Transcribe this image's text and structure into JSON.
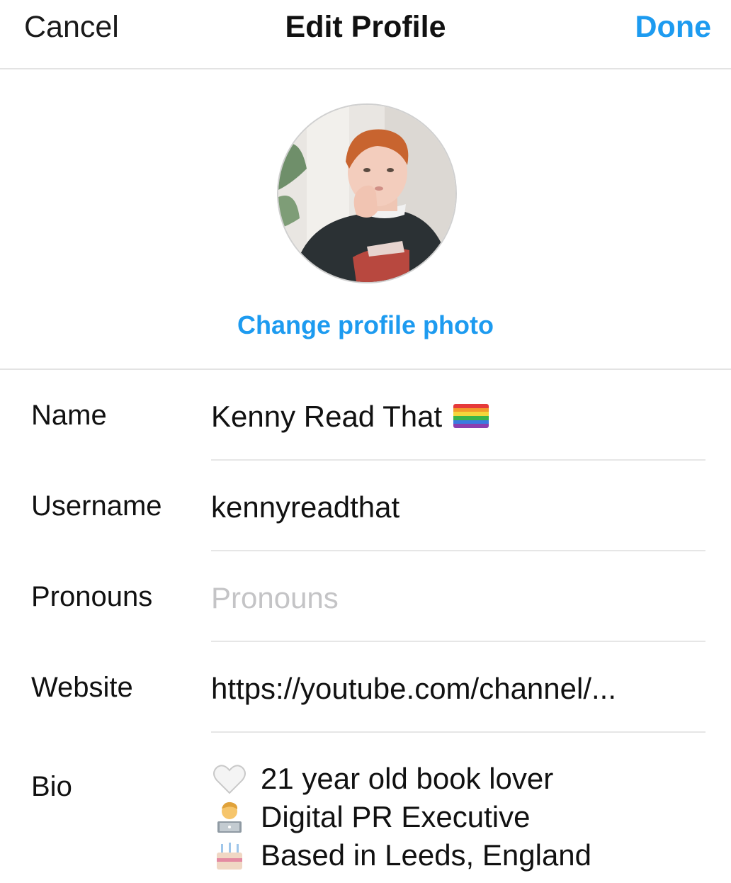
{
  "nav": {
    "cancel_label": "Cancel",
    "title": "Edit Profile",
    "done_label": "Done",
    "accent_color": "#1d9bf0"
  },
  "photo": {
    "change_label": "Change profile photo"
  },
  "fields": {
    "name": {
      "label": "Name",
      "value": "Kenny Read That",
      "emoji": "rainbow-flag"
    },
    "username": {
      "label": "Username",
      "value": "kennyreadthat"
    },
    "pronouns": {
      "label": "Pronouns",
      "placeholder": "Pronouns"
    },
    "website": {
      "label": "Website",
      "value": "https://youtube.com/channel/..."
    }
  },
  "bio": {
    "label": "Bio",
    "lines": [
      {
        "icon": "white-heart-emoji",
        "text": "21 year old book lover"
      },
      {
        "icon": "man-technologist-emoji",
        "text": "Digital PR Executive"
      },
      {
        "icon": "birthday-cake-emoji",
        "text": "Based in Leeds, England"
      }
    ]
  }
}
